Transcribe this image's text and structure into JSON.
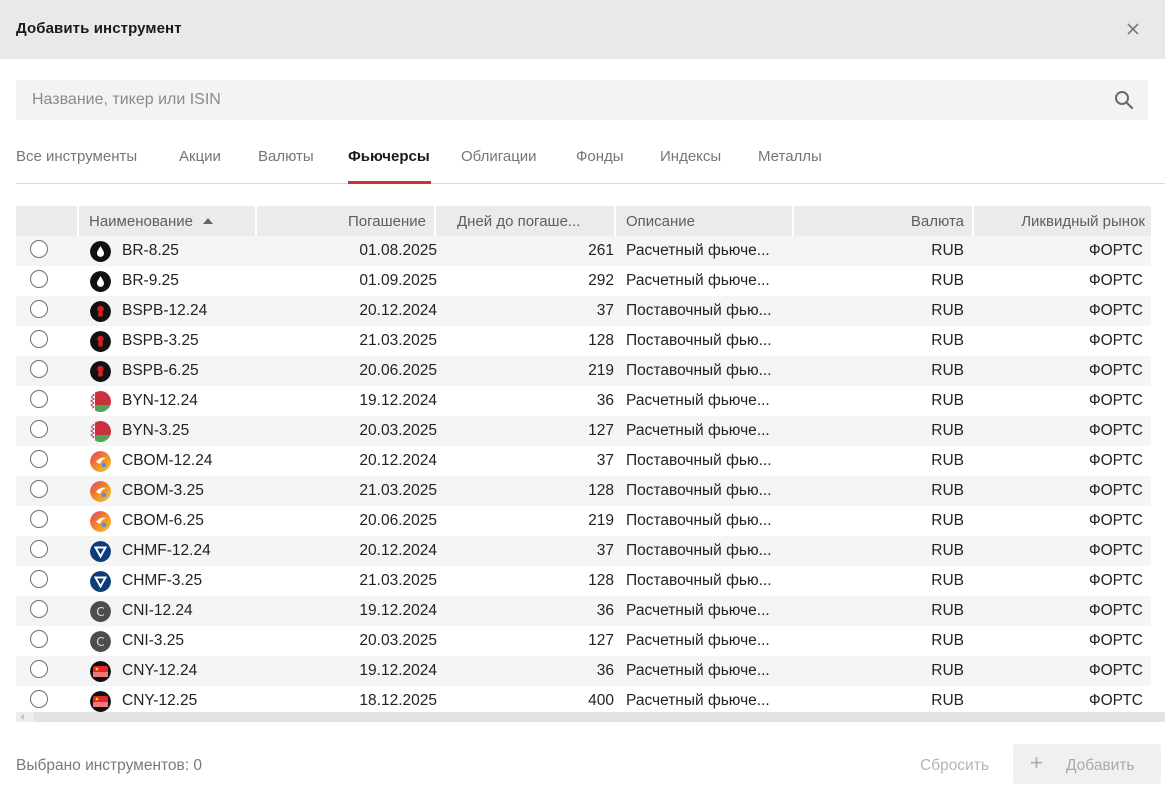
{
  "dialog": {
    "title": "Добавить инструмент"
  },
  "search": {
    "placeholder": "Название, тикер или ISIN"
  },
  "tabs": [
    {
      "label": "Все инструменты",
      "active": false
    },
    {
      "label": "Акции",
      "active": false
    },
    {
      "label": "Валюты",
      "active": false
    },
    {
      "label": "Фьючерсы",
      "active": true
    },
    {
      "label": "Облигации",
      "active": false
    },
    {
      "label": "Фонды",
      "active": false
    },
    {
      "label": "Индексы",
      "active": false
    },
    {
      "label": "Металлы",
      "active": false
    }
  ],
  "table": {
    "columns": {
      "name": "Наименование",
      "maturity": "Погашение",
      "days": "Дней до погаше...",
      "description": "Описание",
      "currency": "Валюта",
      "market": "Ликвидный рынок"
    },
    "sort": {
      "column": "name",
      "direction": "asc"
    },
    "rows": [
      {
        "logo": "oil-drop-icon",
        "name": "BR-8.25",
        "maturity": "01.08.2025",
        "days": "261",
        "description": "Расчетный фьюче...",
        "currency": "RUB",
        "market": "ФОРТС"
      },
      {
        "logo": "oil-drop-icon",
        "name": "BR-9.25",
        "maturity": "01.09.2025",
        "days": "292",
        "description": "Расчетный фьюче...",
        "currency": "RUB",
        "market": "ФОРТС"
      },
      {
        "logo": "bspb-logo-icon",
        "name": "BSPB-12.24",
        "maturity": "20.12.2024",
        "days": "37",
        "description": "Поставочный фью...",
        "currency": "RUB",
        "market": "ФОРТС"
      },
      {
        "logo": "bspb-logo-icon",
        "name": "BSPB-3.25",
        "maturity": "21.03.2025",
        "days": "128",
        "description": "Поставочный фью...",
        "currency": "RUB",
        "market": "ФОРТС"
      },
      {
        "logo": "bspb-logo-icon",
        "name": "BSPB-6.25",
        "maturity": "20.06.2025",
        "days": "219",
        "description": "Поставочный фью...",
        "currency": "RUB",
        "market": "ФОРТС"
      },
      {
        "logo": "belarus-flag-icon",
        "name": "BYN-12.24",
        "maturity": "19.12.2024",
        "days": "36",
        "description": "Расчетный фьюче...",
        "currency": "RUB",
        "market": "ФОРТС"
      },
      {
        "logo": "belarus-flag-icon",
        "name": "BYN-3.25",
        "maturity": "20.03.2025",
        "days": "127",
        "description": "Расчетный фьюче...",
        "currency": "RUB",
        "market": "ФОРТС"
      },
      {
        "logo": "cbom-logo-icon",
        "name": "CBOM-12.24",
        "maturity": "20.12.2024",
        "days": "37",
        "description": "Поставочный фью...",
        "currency": "RUB",
        "market": "ФОРТС"
      },
      {
        "logo": "cbom-logo-icon",
        "name": "CBOM-3.25",
        "maturity": "21.03.2025",
        "days": "128",
        "description": "Поставочный фью...",
        "currency": "RUB",
        "market": "ФОРТС"
      },
      {
        "logo": "cbom-logo-icon",
        "name": "CBOM-6.25",
        "maturity": "20.06.2025",
        "days": "219",
        "description": "Поставочный фью...",
        "currency": "RUB",
        "market": "ФОРТС"
      },
      {
        "logo": "chmf-logo-icon",
        "name": "CHMF-12.24",
        "maturity": "20.12.2024",
        "days": "37",
        "description": "Поставочный фью...",
        "currency": "RUB",
        "market": "ФОРТС"
      },
      {
        "logo": "chmf-logo-icon",
        "name": "CHMF-3.25",
        "maturity": "21.03.2025",
        "days": "128",
        "description": "Поставочный фью...",
        "currency": "RUB",
        "market": "ФОРТС"
      },
      {
        "logo": "cni-logo-icon",
        "name": "CNI-12.24",
        "maturity": "19.12.2024",
        "days": "36",
        "description": "Расчетный фьюче...",
        "currency": "RUB",
        "market": "ФОРТС"
      },
      {
        "logo": "cni-logo-icon",
        "name": "CNI-3.25",
        "maturity": "20.03.2025",
        "days": "127",
        "description": "Расчетный фьюче...",
        "currency": "RUB",
        "market": "ФОРТС"
      },
      {
        "logo": "china-flag-icon",
        "name": "CNY-12.24",
        "maturity": "19.12.2024",
        "days": "36",
        "description": "Расчетный фьюче...",
        "currency": "RUB",
        "market": "ФОРТС"
      },
      {
        "logo": "china-flag-icon",
        "name": "CNY-12.25",
        "maturity": "18.12.2025",
        "days": "400",
        "description": "Расчетный фьюче...",
        "currency": "RUB",
        "market": "ФОРТС"
      }
    ]
  },
  "footer": {
    "selected_label": "Выбрано инструментов: 0",
    "reset_label": "Сбросить",
    "add_label": "Добавить"
  },
  "colors": {
    "accent": "#d0312d",
    "header_bg": "#e9e9e9",
    "table_header_bg": "#ebebeb",
    "row_alt_bg": "#f5f5f5"
  }
}
